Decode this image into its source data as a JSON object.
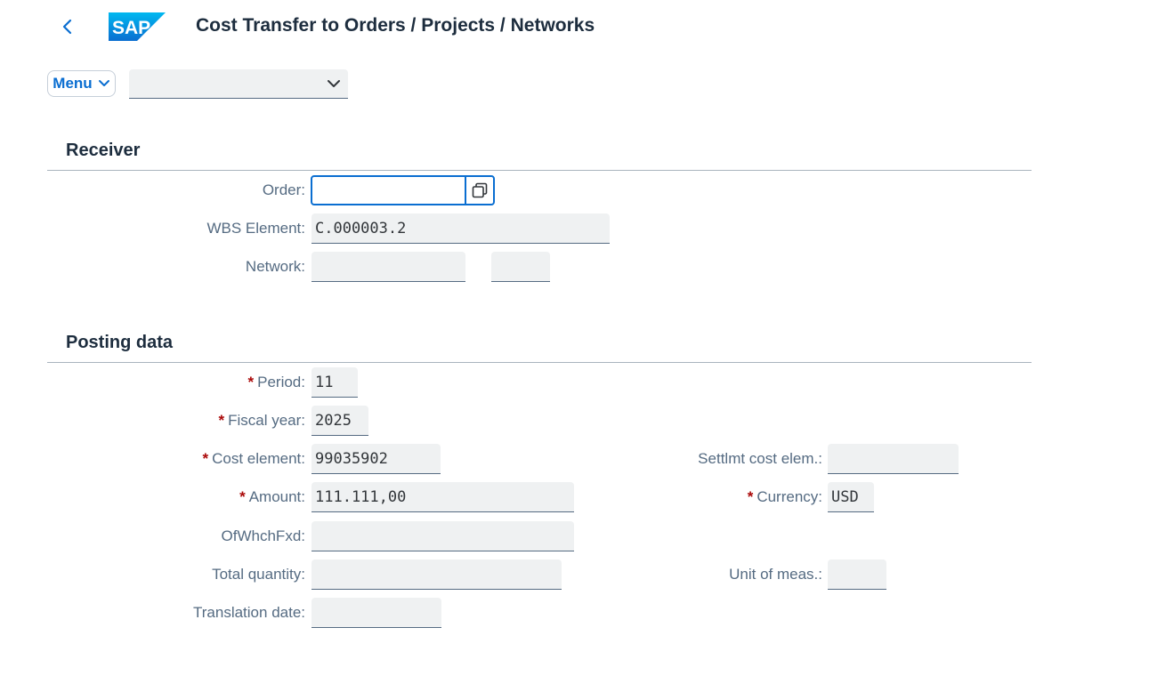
{
  "header": {
    "title": "Cost Transfer to Orders / Projects / Networks",
    "logo_text": "SAP",
    "back_icon": "chevron-left-icon"
  },
  "toolbar": {
    "menu_label": "Menu",
    "dropdown_value": ""
  },
  "receiver": {
    "section_title": "Receiver",
    "order_label": "Order:",
    "order_value": "",
    "wbs_label": "WBS Element:",
    "wbs_value": "C.000003.2",
    "network_label": "Network:",
    "network_value": "",
    "network_activity_value": ""
  },
  "posting": {
    "section_title": "Posting data",
    "period_label": "Period:",
    "period_value": "11",
    "fiscal_year_label": "Fiscal year:",
    "fiscal_year_value": "2025",
    "cost_element_label": "Cost element:",
    "cost_element_value": "99035902",
    "settlmt_label": "Settlmt cost elem.:",
    "settlmt_value": "",
    "amount_label": "Amount:",
    "amount_value": "111.111,00",
    "currency_label": "Currency:",
    "currency_value": "USD",
    "ofwhchfxd_label": "OfWhchFxd:",
    "ofwhchfxd_value": "",
    "total_qty_label": "Total quantity:",
    "total_qty_value": "",
    "unit_label": "Unit of meas.:",
    "unit_value": "",
    "translation_label": "Translation date:",
    "translation_value": ""
  },
  "required_marker": "*",
  "colors": {
    "accent": "#0a6ed1",
    "required": "#aa0808",
    "field_bg": "#eff1f2"
  }
}
